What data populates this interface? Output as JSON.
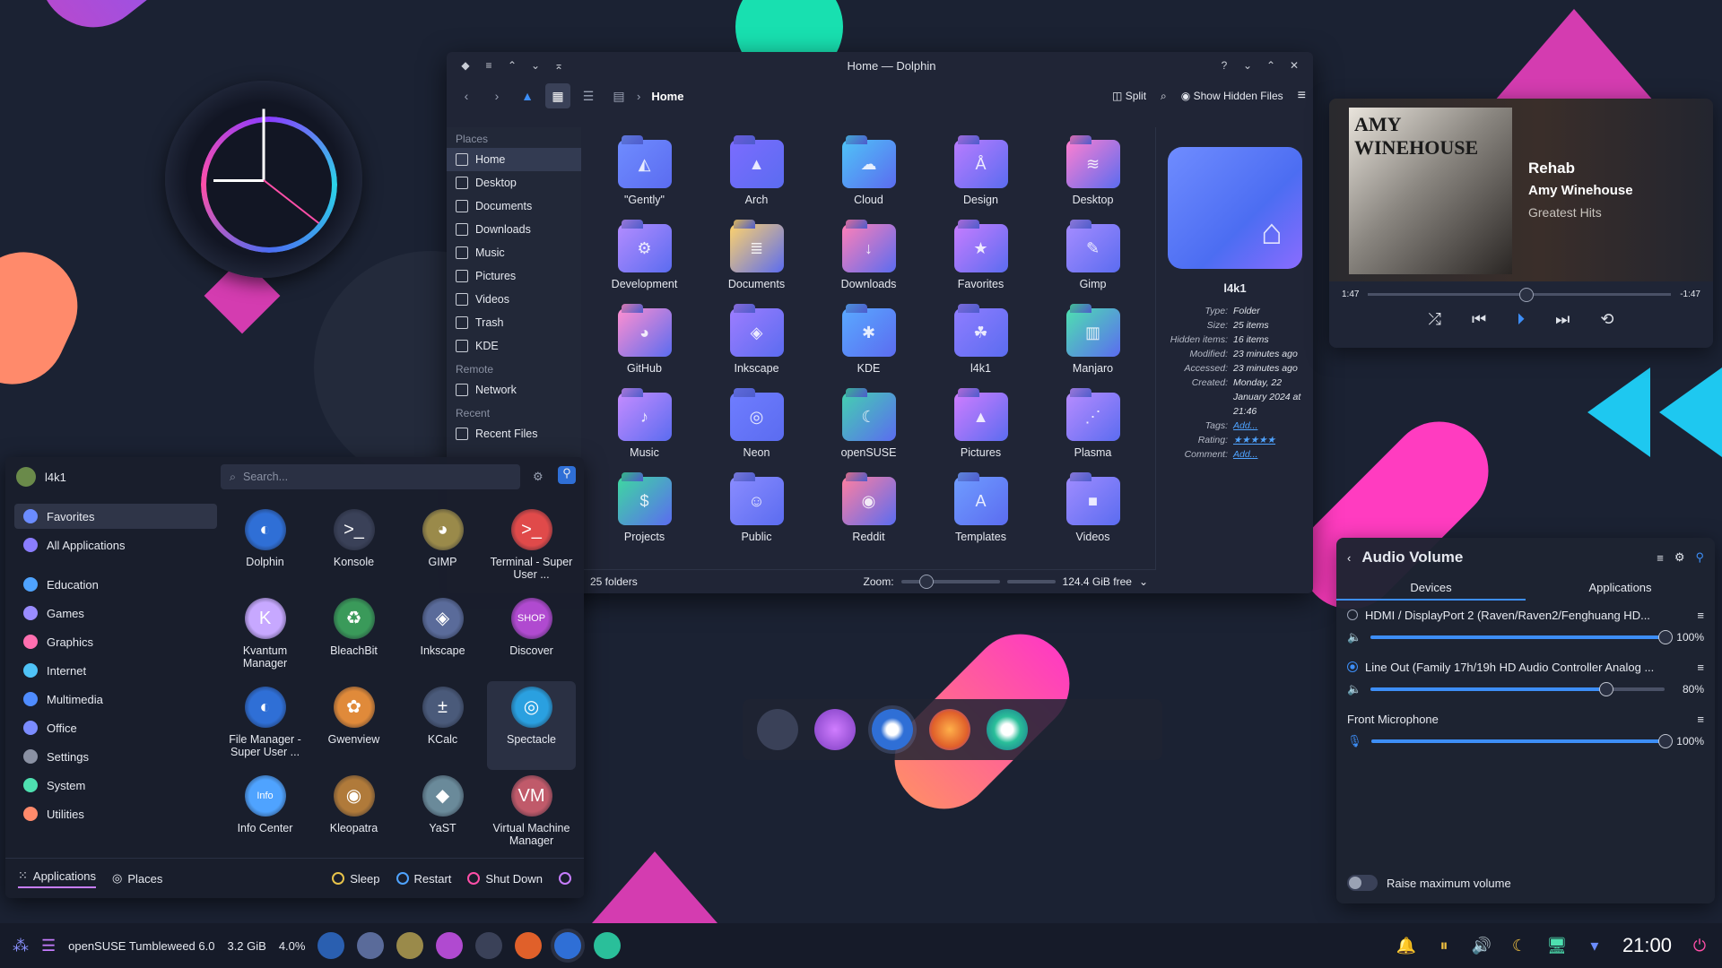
{
  "dolphin": {
    "title": "Home — Dolphin",
    "breadcrumb": "Home",
    "split_label": "Split",
    "hidden_files_label": "Show Hidden Files",
    "places_header": "Places",
    "remote_header": "Remote",
    "recent_header": "Recent",
    "places": [
      "Home",
      "Desktop",
      "Documents",
      "Downloads",
      "Music",
      "Pictures",
      "Videos",
      "Trash",
      "KDE"
    ],
    "remote": [
      "Network"
    ],
    "recent": [
      "Recent Files"
    ],
    "folders": [
      {
        "name": "\"Gently\"",
        "color": "#6f8cff",
        "glyph": "◭"
      },
      {
        "name": "Arch",
        "color": "#7b6cff",
        "glyph": "▲"
      },
      {
        "name": "Cloud",
        "color": "#4fc3f7",
        "glyph": "☁"
      },
      {
        "name": "Design",
        "color": "#b97cff",
        "glyph": "Å"
      },
      {
        "name": "Desktop",
        "color": "#ff7fd0",
        "glyph": "≋"
      },
      {
        "name": "Development",
        "color": "#b38cff",
        "glyph": "⚙"
      },
      {
        "name": "Documents",
        "color": "#ffd36b",
        "glyph": "≣"
      },
      {
        "name": "Downloads",
        "color": "#ff7fb7",
        "glyph": "↓"
      },
      {
        "name": "Favorites",
        "color": "#c77dff",
        "glyph": "★"
      },
      {
        "name": "Gimp",
        "color": "#a58cff",
        "glyph": "✎"
      },
      {
        "name": "GitHub",
        "color": "#ff8fd0",
        "glyph": "◕"
      },
      {
        "name": "Inkscape",
        "color": "#9d7dff",
        "glyph": "◈"
      },
      {
        "name": "KDE",
        "color": "#5aa9ff",
        "glyph": "✱"
      },
      {
        "name": "l4k1",
        "color": "#8f7dff",
        "glyph": "☘"
      },
      {
        "name": "Manjaro",
        "color": "#4ee0b0",
        "glyph": "▥"
      },
      {
        "name": "Music",
        "color": "#c58cff",
        "glyph": "♪"
      },
      {
        "name": "Neon",
        "color": "#6f7dff",
        "glyph": "◎"
      },
      {
        "name": "openSUSE",
        "color": "#44d0b0",
        "glyph": "☾"
      },
      {
        "name": "Pictures",
        "color": "#d07dff",
        "glyph": "▲"
      },
      {
        "name": "Plasma",
        "color": "#b78cff",
        "glyph": "⋰"
      },
      {
        "name": "Projects",
        "color": "#3ed8a0",
        "glyph": "$"
      },
      {
        "name": "Public",
        "color": "#8a8cff",
        "glyph": "☺"
      },
      {
        "name": "Reddit",
        "color": "#ff7fa0",
        "glyph": "◉"
      },
      {
        "name": "Templates",
        "color": "#6f9cff",
        "glyph": "A"
      },
      {
        "name": "Videos",
        "color": "#9f8cff",
        "glyph": "■"
      }
    ],
    "status": "25 folders",
    "zoom_label": "Zoom:",
    "free_space": "124.4 GiB free",
    "info": {
      "name": "l4k1",
      "rows": [
        {
          "k": "Type:",
          "v": "Folder",
          "link": false
        },
        {
          "k": "Size:",
          "v": "25 items",
          "link": false
        },
        {
          "k": "Hidden items:",
          "v": "16 items",
          "link": false
        },
        {
          "k": "Modified:",
          "v": "23 minutes ago",
          "link": false
        },
        {
          "k": "Accessed:",
          "v": "23 minutes ago",
          "link": false
        },
        {
          "k": "Created:",
          "v": "Monday, 22 January 2024 at 21:46",
          "link": false
        },
        {
          "k": "Tags:",
          "v": "Add...",
          "link": true
        },
        {
          "k": "Rating:",
          "v": "★★★★★",
          "link": true
        },
        {
          "k": "Comment:",
          "v": "Add...",
          "link": true
        }
      ]
    }
  },
  "launcher": {
    "user": "l4k1",
    "search_placeholder": "Search...",
    "categories": [
      {
        "label": "Favorites",
        "color": "#6b8cff"
      },
      {
        "label": "All Applications",
        "color": "#8a7dff"
      },
      {
        "label": "Education",
        "color": "#4fa3ff"
      },
      {
        "label": "Games",
        "color": "#9a8cff"
      },
      {
        "label": "Graphics",
        "color": "#ff6fb0"
      },
      {
        "label": "Internet",
        "color": "#4fc3f7"
      },
      {
        "label": "Multimedia",
        "color": "#4f8cff"
      },
      {
        "label": "Office",
        "color": "#7b8cff"
      },
      {
        "label": "Settings",
        "color": "#8a91a3"
      },
      {
        "label": "System",
        "color": "#4ee0b0"
      },
      {
        "label": "Utilities",
        "color": "#ff8a6b"
      }
    ],
    "apps": [
      {
        "label": "Dolphin",
        "color": "#2f6fd6",
        "glyph": "◐"
      },
      {
        "label": "Konsole",
        "color": "#3a4158",
        "glyph": ">_"
      },
      {
        "label": "GIMP",
        "color": "#9a8a4a",
        "glyph": "◕"
      },
      {
        "label": "Terminal - Super User ...",
        "color": "#e04a4a",
        "glyph": ">_"
      },
      {
        "label": "Kvantum Manager",
        "color": "#c7a8ff",
        "glyph": "K"
      },
      {
        "label": "BleachBit",
        "color": "#3a9a5a",
        "glyph": "♻"
      },
      {
        "label": "Inkscape",
        "color": "#5a6b9a",
        "glyph": "◈"
      },
      {
        "label": "Discover",
        "color": "#b04ad0",
        "glyph": "SHOP"
      },
      {
        "label": "File Manager - Super User ...",
        "color": "#2f6fd6",
        "glyph": "◐"
      },
      {
        "label": "Gwenview",
        "color": "#e08a3a",
        "glyph": "✿"
      },
      {
        "label": "KCalc",
        "color": "#4a5a7a",
        "glyph": "±"
      },
      {
        "label": "Spectacle",
        "color": "#2aa0e0",
        "glyph": "◎"
      },
      {
        "label": "Info Center",
        "color": "#4fa3ff",
        "glyph": "Info"
      },
      {
        "label": "Kleopatra",
        "color": "#b07a3a",
        "glyph": "◉"
      },
      {
        "label": "YaST",
        "color": "#6a8a9a",
        "glyph": "◆"
      },
      {
        "label": "Virtual Machine Manager",
        "color": "#c05a6a",
        "glyph": "VM"
      }
    ],
    "footer": {
      "applications": "Applications",
      "places": "Places",
      "sleep": "Sleep",
      "restart": "Restart",
      "shutdown": "Shut Down"
    }
  },
  "player": {
    "cover_text": "AMY WINEHOUSE",
    "title": "Rehab",
    "artist": "Amy Winehouse",
    "album": "Greatest Hits",
    "elapsed": "1:47",
    "remaining": "-1:47",
    "progress": 0.5
  },
  "audio": {
    "title": "Audio Volume",
    "tab_devices": "Devices",
    "tab_applications": "Applications",
    "devices": [
      {
        "name": "HDMI / DisplayPort 2 (Raven/Raven2/Fenghuang HD...",
        "volume": 100,
        "pct": "100%",
        "selected": false
      },
      {
        "name": "Line Out (Family 17h/19h HD Audio Controller Analog ...",
        "volume": 80,
        "pct": "80%",
        "selected": true
      }
    ],
    "mic_header": "Front Microphone",
    "mic": {
      "volume": 100,
      "pct": "100%"
    },
    "raise_label": "Raise maximum volume"
  },
  "panel": {
    "os": "openSUSE Tumbleweed 6.0",
    "ram": "3.2 GiB",
    "cpu": "4.0%",
    "time": "21:00"
  }
}
